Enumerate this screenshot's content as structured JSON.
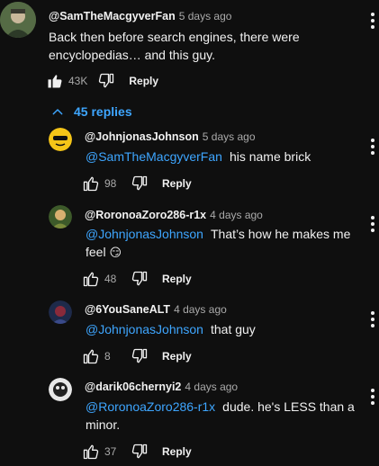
{
  "top_comment": {
    "author": "@SamTheMacgyverFan",
    "time": "5 days ago",
    "text": "Back then before search engines, there were encyclopedias… and this guy.",
    "likes": "43K",
    "reply_label": "Reply"
  },
  "replies_toggle": {
    "label": "45 replies"
  },
  "replies": [
    {
      "author": "@JohnjonasJohnson",
      "time": "5 days ago",
      "mention": "@SamTheMacgyverFan",
      "text": "his name brick",
      "likes": "98",
      "reply_label": "Reply"
    },
    {
      "author": "@RoronoaZoro286-r1x",
      "time": "4 days ago",
      "mention": "@JohnjonasJohnson",
      "text": "That’s how he makes me feel",
      "emoji": "😏",
      "likes": "48",
      "reply_label": "Reply"
    },
    {
      "author": "@6YouSaneALT",
      "time": "4 days ago",
      "mention": "@JohnjonasJohnson",
      "text": "that guy",
      "likes": "8",
      "reply_label": "Reply"
    },
    {
      "author": "@darik06chernyi2",
      "time": "4 days ago",
      "mention": "@RoronoaZoro286-r1x",
      "text": "dude. he's LESS than a minor.",
      "likes": "37",
      "reply_label": "Reply"
    }
  ],
  "colors": {
    "background": "#0f0f0f",
    "text": "#f1f1f1",
    "secondary": "#aaaaaa",
    "link": "#3ea6ff"
  }
}
